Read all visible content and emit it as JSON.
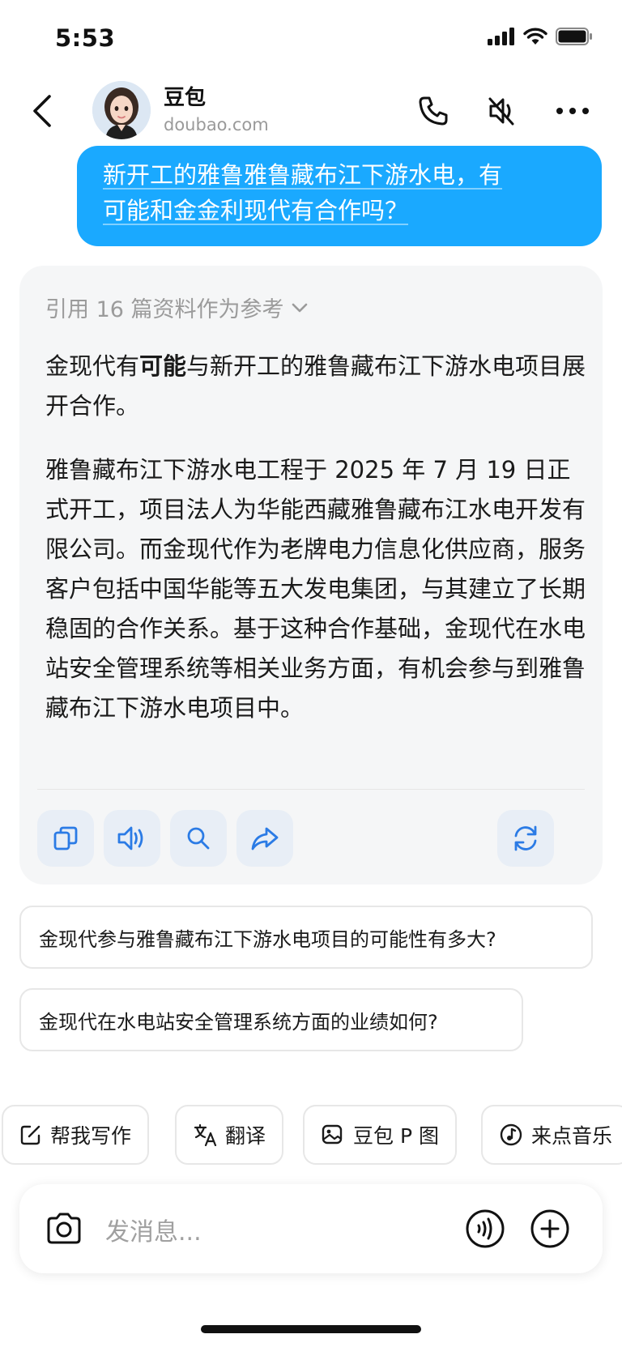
{
  "status_bar": {
    "time": "5:53"
  },
  "header": {
    "bot_name": "豆包",
    "bot_domain": "doubao.com",
    "icons": [
      "back-icon",
      "phone-icon",
      "speaker-muted-icon",
      "more-icon"
    ]
  },
  "user_message": {
    "line1": "新开工的雅鲁雅鲁藏布江下游水电，有",
    "line2": "可能和金金利现代有合作吗？"
  },
  "bot_message": {
    "references": "引用 16 篇资料作为参考",
    "p1_part1": "金现代有",
    "p1_bold": "可能",
    "p1_part2": "与新开工的雅鲁藏布江下游水电项目展开合作。",
    "p2": "雅鲁藏布江下游水电工程于 2025 年 7 月 19 日正式开工，项目法人为华能西藏雅鲁藏布江水电开发有限公司。而金现代作为老牌电力信息化供应商，服务客户包括中国华能等五大发电集团，与其建立了长期稳固的合作关系。基于这种合作基础，金现代在水电站安全管理系统等相关业务方面，有机会参与到雅鲁藏布江下游水电项目中。",
    "actions": [
      "copy-icon",
      "speaker-icon",
      "search-icon",
      "share-icon",
      "regenerate-icon"
    ]
  },
  "suggestions": [
    "金现代参与雅鲁藏布江下游水电项目的可能性有多大?",
    "金现代在水电站安全管理系统方面的业绩如何?"
  ],
  "shortcuts": [
    {
      "label": "帮我写作",
      "icon": "edit-icon"
    },
    {
      "label": "翻译",
      "icon": "translate-icon"
    },
    {
      "label": "豆包 P 图",
      "icon": "image-edit-icon"
    },
    {
      "label": "来点音乐",
      "icon": "music-icon"
    }
  ],
  "input": {
    "placeholder": "发消息..."
  },
  "colors": {
    "accent": "#1aa9ff",
    "icon_blue": "#2b7be5",
    "card_bg": "#f5f6f7"
  }
}
